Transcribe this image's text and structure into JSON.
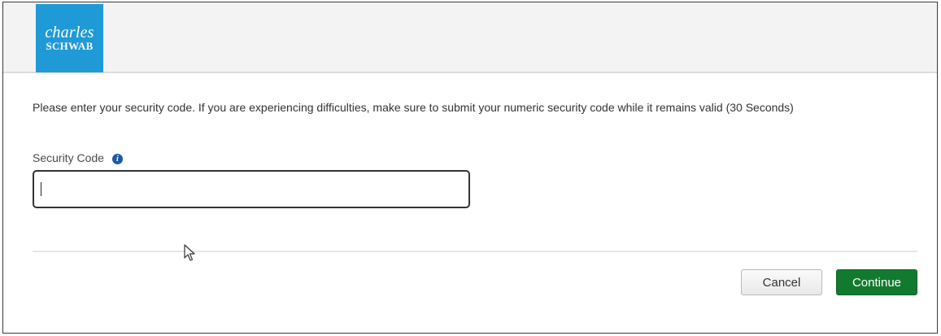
{
  "brand": {
    "logo_line1": "charles",
    "logo_line2": "SCHWAB",
    "logo_color": "#1f9ad7"
  },
  "form": {
    "instructions": "Please enter your security code. If you are experiencing difficulties, make sure to submit your numeric security code while it remains valid (30 Seconds)",
    "security_code_label": "Security Code",
    "info_icon": "info-icon",
    "security_code_value": "",
    "security_code_placeholder": ""
  },
  "actions": {
    "cancel_label": "Cancel",
    "continue_label": "Continue",
    "continue_color": "#127a2e"
  }
}
